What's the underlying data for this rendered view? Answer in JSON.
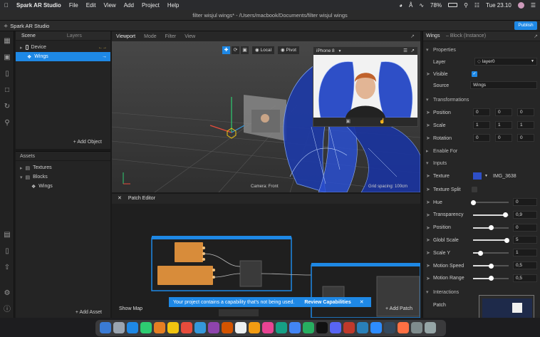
{
  "menubar": {
    "apple": "",
    "app_name": "Spark AR Studio",
    "items": [
      "File",
      "Edit",
      "View",
      "Add",
      "Project",
      "Help"
    ],
    "battery": "78%",
    "clock": "Tue 23.10"
  },
  "window": {
    "title": "filter wisjul wings* - /Users/macbook/Documents/filter wisjul wings",
    "app_label": "Spark AR Studio",
    "publish_label": "Publish"
  },
  "scene": {
    "tabs": [
      "Scene",
      "Layers"
    ],
    "items": [
      {
        "label": "Device",
        "selected": false
      },
      {
        "label": "Wings",
        "selected": true
      }
    ],
    "add_object_label": "Add Object"
  },
  "assets": {
    "header": "Assets",
    "items": [
      {
        "label": "Textures"
      },
      {
        "label": "Blocks"
      },
      {
        "label": "Wings"
      }
    ],
    "add_asset_label": "Add Asset"
  },
  "viewport": {
    "tabs": [
      "Viewport",
      "Mode",
      "Filter",
      "View"
    ],
    "local_label": "Local",
    "pivot_label": "Pivot",
    "device_label": "iPhone 8",
    "camera_label": "Camera: Front",
    "grid_label": "Grid spacing: 100cm"
  },
  "patch_editor": {
    "title": "Patch Editor",
    "show_map_label": "Show Map",
    "add_patch_label": "Add Patch",
    "toast_text": "Your project contains a capability that's not being used.",
    "toast_action": "Review Capabilities"
  },
  "properties": {
    "header_name": "Wings",
    "header_type": "– Block (Instance)",
    "sections": {
      "properties": "Properties",
      "transformations": "Transformations",
      "enable_for": "Enable For",
      "inputs": "Inputs",
      "interactions": "Interactions"
    },
    "layer": {
      "label": "Layer",
      "value": "layer0"
    },
    "visible": {
      "label": "Visible"
    },
    "source": {
      "label": "Source",
      "value": "Wings"
    },
    "position": {
      "label": "Position",
      "values": [
        "0",
        "0",
        "0"
      ]
    },
    "scale": {
      "label": "Scale",
      "values": [
        "1",
        "1",
        "1"
      ]
    },
    "rotation": {
      "label": "Rotation",
      "values": [
        "0",
        "0",
        "0"
      ]
    },
    "texture": {
      "label": "Texture",
      "value": "IMG_3638"
    },
    "texture_split": {
      "label": "Texture Split"
    },
    "sliders": [
      {
        "label": "Hue",
        "value": "0",
        "level": 0.0
      },
      {
        "label": "Transparency",
        "value": "0,9",
        "level": 0.9
      },
      {
        "label": "Position",
        "value": "0",
        "level": 0.5
      },
      {
        "label": "Globl Scale",
        "value": "5",
        "level": 0.95
      },
      {
        "label": "Scale Y",
        "value": "1",
        "level": 0.2
      },
      {
        "label": "Motion Speed",
        "value": "0,5",
        "level": 0.5
      },
      {
        "label": "Motion Range",
        "value": "0,5",
        "level": 0.5
      }
    ],
    "patch": {
      "label": "Patch"
    }
  },
  "colors": {
    "accent": "#1e88e5",
    "panel": "#262626",
    "patch_orange": "#d88c3a"
  }
}
